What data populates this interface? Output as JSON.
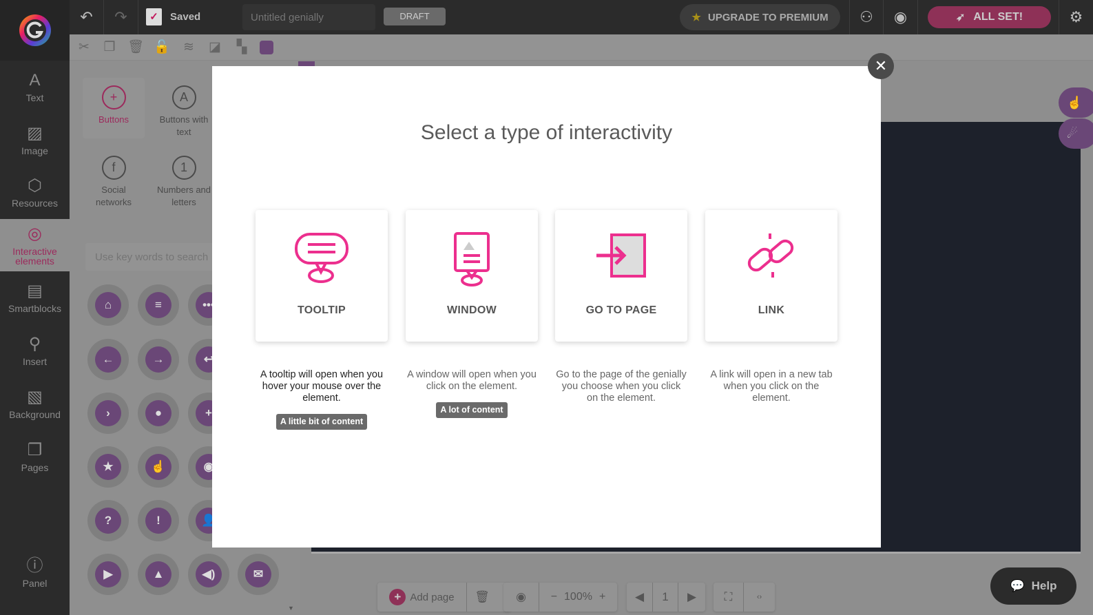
{
  "topbar": {
    "saved_label": "Saved",
    "title_placeholder": "Untitled genially",
    "draft_label": "DRAFT",
    "upgrade_label": "UPGRADE TO PREMIUM",
    "allset_label": "ALL SET!"
  },
  "sidebar": {
    "items": [
      {
        "label": "Text",
        "icon": "A"
      },
      {
        "label": "Image",
        "icon": "▨"
      },
      {
        "label": "Resources",
        "icon": "⬡"
      },
      {
        "label": "Interactive elements",
        "icon": "◎"
      },
      {
        "label": "Smartblocks",
        "icon": "▤"
      },
      {
        "label": "Insert",
        "icon": "⚲"
      },
      {
        "label": "Background",
        "icon": "▧"
      },
      {
        "label": "Pages",
        "icon": "❐"
      },
      {
        "label": "Panel",
        "icon": "ⓘ"
      }
    ]
  },
  "panel": {
    "categories": [
      {
        "label": "Buttons",
        "icon": "+"
      },
      {
        "label": "Buttons with text",
        "icon": "A"
      },
      {
        "label": "Social networks",
        "icon": "f"
      },
      {
        "label": "Numbers and letters",
        "icon": "1"
      }
    ],
    "search_placeholder": "Use key words to search",
    "button_icons": [
      "⌂",
      "≡",
      "•••",
      "←",
      "→",
      "↩",
      "›",
      "●",
      "+",
      "★",
      "☝",
      "◉",
      "?",
      "!",
      "👤",
      "▶",
      "▲",
      "◀)",
      "✉"
    ]
  },
  "modal": {
    "title": "Select a type of interactivity",
    "options": [
      {
        "label": "TOOLTIP",
        "description": "A tooltip will open when you hover your mouse over the element.",
        "badge": "A little bit of content"
      },
      {
        "label": "WINDOW",
        "description": "A window will open when you click on the element.",
        "badge": "A lot of content"
      },
      {
        "label": "GO TO PAGE",
        "description": "Go to the page of the genially you choose when you click on the element."
      },
      {
        "label": "LINK",
        "description": "A link will open in a new tab when you click on the element."
      }
    ]
  },
  "bottombar": {
    "add_page_label": "Add page",
    "zoom": "100%",
    "page": "1"
  },
  "help_label": "Help",
  "colors": {
    "accent": "#e91e8c",
    "allset": "#8e3157",
    "purple": "#6a4777"
  }
}
